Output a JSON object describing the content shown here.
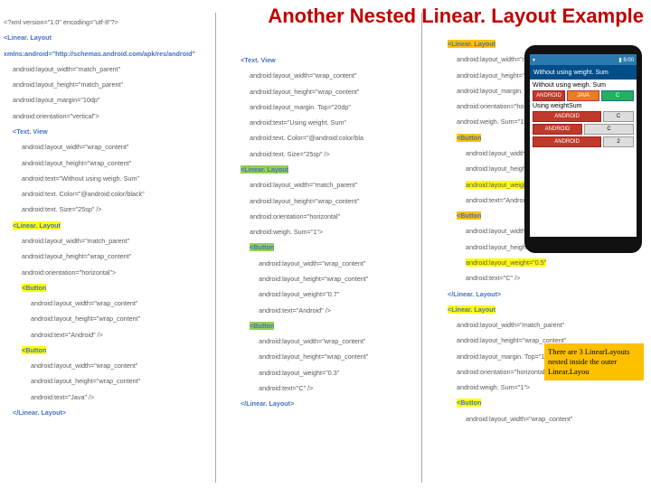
{
  "title": "Another Nested Linear. Layout Example",
  "col1": {
    "l01": "<?xml version=\"1.0\" encoding=\"utf-8\"?>",
    "l02": "<Linear. Layout xmlns:android=\"http://schemas.android.com/apk/res/android\"",
    "l03": "android:layout_width=\"match_parent\"",
    "l04": "android:layout_height=\"match_parent\"",
    "l05": "android:layout_margin=\"10dp\"",
    "l06": "android:orientation=\"vertical\">",
    "l07": "<Text. View",
    "l08": "android:layout_width=\"wrap_content\"",
    "l09": "android:layout_height=\"wrap_content\"",
    "l10": "android:text=\"Without using weigh. Sum\"",
    "l11": "android:text. Color=\"@android:color/black\"",
    "l12": "android:text. Size=\"25sp\" />",
    "l13": "<Linear. Layout",
    "l14": "android:layout_width=\"match_parent\"",
    "l15": "android:layout_height=\"wrap_content\"",
    "l16": "android:orientation=\"horizontal\">",
    "l17": "<Button",
    "l18": "android:layout_width=\"wrap_content\"",
    "l19": "android:layout_height=\"wrap_content\"",
    "l20": "android:text=\"Android\" />",
    "l21": "<Button",
    "l22": "android:layout_width=\"wrap_content\"",
    "l23": "android:layout_height=\"wrap_content\"",
    "l24": "android:text=\"Java\" />",
    "l25": "</Linear. Layout>"
  },
  "col2": {
    "l01": "<Text. View",
    "l02": "android:layout_width=\"wrap_content\"",
    "l03": "android:layout_height=\"wrap_content\"",
    "l04": "android:layout_margin. Top=\"20dp\"",
    "l05": "android:text=\"Using weight. Sum\"",
    "l06": "android:text. Color=\"@android:color/bla",
    "l07": "android:text. Size=\"25sp\" />",
    "l08": "<Linear. Layout",
    "l09": "android:layout_width=\"match_parent\"",
    "l10": "android:layout_height=\"wrap_content\"",
    "l11": "android:orientation=\"horizontal\"",
    "l12": "android:weigh. Sum=\"1\">",
    "l13": "<Button",
    "l14": "android:layout_width=\"wrap_content\"",
    "l15": "android:layout_height=\"wrap_content\"",
    "l16": "android:layout_weight=\"0.7\"",
    "l17": "android:text=\"Android\" />",
    "l18": "<Button",
    "l19": "android:layout_width=\"wrap_content\"",
    "l20": "android:layout_height=\"wrap_content\"",
    "l21": "android:layout_weight=\"0.3\"",
    "l22": "android:text=\"C\" />",
    "l23": "</Linear. Layout>"
  },
  "col3": {
    "l01": "<Linear. Layout",
    "l02": "android:layout_width=\"match_pa",
    "l03": "android:layout_height=\"wrap_co",
    "l04": "android:layout_margin. Top=\"10d",
    "l05": "android:orientation=\"horizontal\"",
    "l06": "android:weigh. Sum=\"1\">",
    "l07": "<Button",
    "l08": "android:layout_width=\"wrap_c",
    "l09": "android:layout_height=\"wrap_",
    "l10": "android:layout_weight=\"0.5\"",
    "l11": "android:text=\"Android\" />",
    "l12": "<Button",
    "l13": "android:layout_width=\"wrap_content\"",
    "l14": "android:layout_height=\"wrap_content\"",
    "l15": "android:layout_weight=\"0.5\"",
    "l16": "android:text=\"C\" />",
    "l17": "</Linear. Layout>",
    "l18": "<Linear. Layout",
    "l19": "android:layout_width=\"match_parent\"",
    "l20": "android:layout_height=\"wrap_content\"",
    "l21": "android:layout_margin. Top=\"10dp\"",
    "l22": "android:orientation=\"horizontal\"",
    "l23": "android:weigh. Sum=\"1\">",
    "l24": "<Button",
    "l25": "android:layout_width=\"wrap_content\""
  },
  "callout": "There are 3 LinearLayouts nested inside the outer Linear.Layou",
  "phone": {
    "header": "Without using weight. Sum",
    "label1": "Without using weigh. Sum",
    "label2": "Using weightSum",
    "btn_android": "ANDROID",
    "btn_java": "JAVA",
    "btn_c": "C"
  }
}
